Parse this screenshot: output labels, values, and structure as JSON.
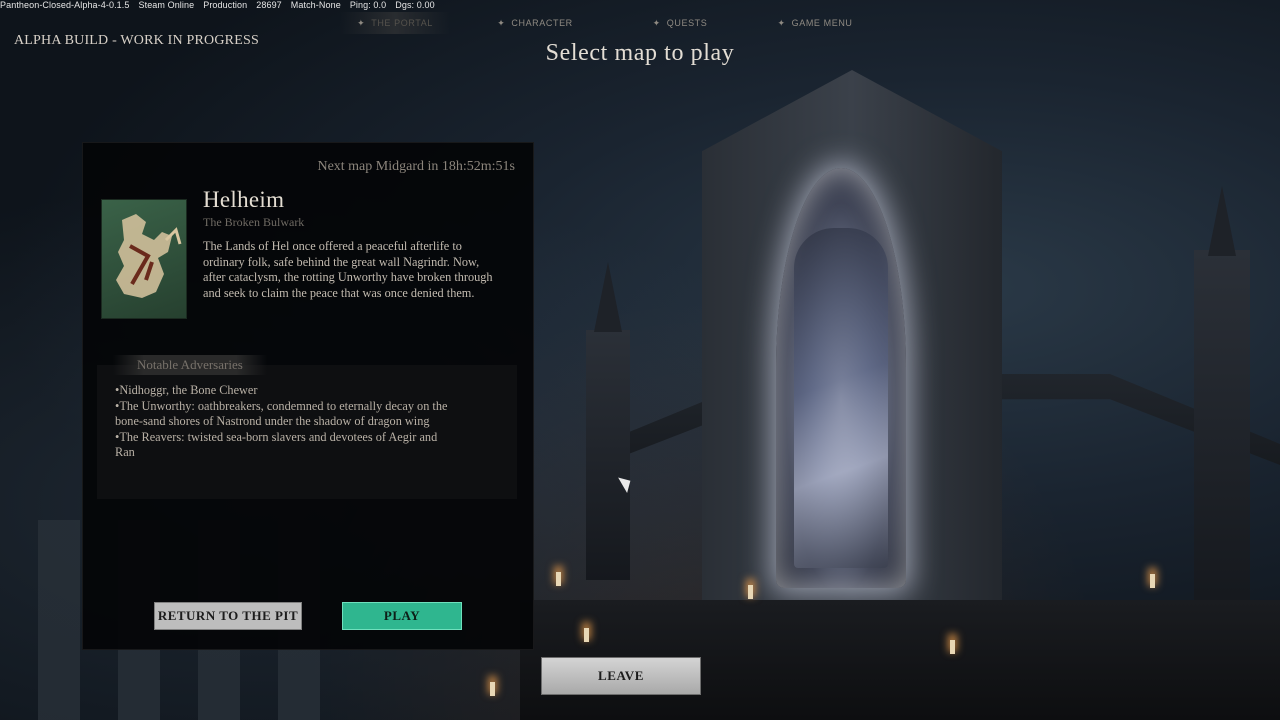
{
  "debug": {
    "build": "Pantheon-Closed-Alpha-4-0.1.5",
    "platform": "Steam Online",
    "env": "Production",
    "id": "28697",
    "match": "Match-None",
    "ping": "Ping: 0.0",
    "dgs": "Dgs: 0.00"
  },
  "nav": {
    "tabs": [
      {
        "label": "THE PORTAL",
        "icon": "diamond-icon",
        "active": true
      },
      {
        "label": "CHARACTER",
        "icon": "diamond-icon",
        "active": false
      },
      {
        "label": "QUESTS",
        "icon": "diamond-icon",
        "active": false
      },
      {
        "label": "GAME MENU",
        "icon": "diamond-icon",
        "active": false
      }
    ]
  },
  "banner": "ALPHA BUILD - WORK IN PROGRESS",
  "heading": "Select map to play",
  "panel": {
    "timer": "Next map Midgard in 18h:52m:51s",
    "map_name": "Helheim",
    "map_subtitle": "The Broken Bulwark",
    "description": "The Lands of Hel once offered a peaceful afterlife to ordinary folk, safe behind the great wall Nagrindr. Now, after cataclysm, the rotting Unworthy have broken through and seek to claim the peace that was once denied them.",
    "adversaries_title": "Notable Adversaries",
    "adversaries": [
      "Nidhoggr, the Bone Chewer",
      "The Unworthy: oathbreakers, condemned to eternally decay on the bone-sand shores of Nastrond under the shadow of dragon wing",
      "The Reavers: twisted sea-born slavers and devotees of Aegir and Ran"
    ],
    "return_label": "RETURN TO THE PIT",
    "play_label": "PLAY"
  },
  "leave_label": "LEAVE",
  "colors": {
    "play_accent": "#2fb68f",
    "panel_bg": "#040507",
    "text_primary": "#e4ddd2"
  }
}
